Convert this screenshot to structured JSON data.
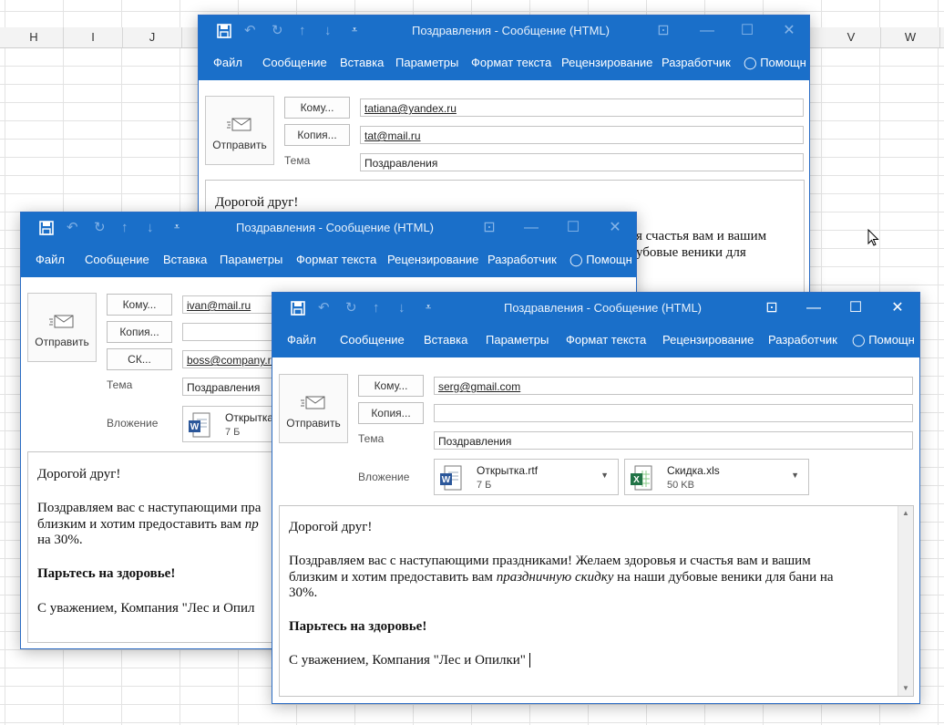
{
  "excel": {
    "columns": [
      "H",
      "I",
      "J",
      "V",
      "W"
    ]
  },
  "colors": {
    "ribbon": "#1a6fc9",
    "word_icon": "#2b579a",
    "excel_icon": "#217346"
  },
  "qat_icons": [
    "save-icon",
    "undo-icon",
    "redo-icon",
    "up-arrow-icon",
    "down-arrow-icon",
    "customize-icon"
  ],
  "menu": [
    "Файл",
    "Сообщение",
    "Вставка",
    "Параметры",
    "Формат текста",
    "Рецензирование",
    "Разработчик",
    "Помощн"
  ],
  "labels": {
    "to": "Кому...",
    "cc": "Копия...",
    "bcc": "СК...",
    "subject": "Тема",
    "attachment": "Вложение",
    "send": "Отправить"
  },
  "window1": {
    "title": "Поздравления - Сообщение (HTML)",
    "to": "tatiana@yandex.ru",
    "cc": "tat@mail.ru",
    "subject": "Поздравления",
    "body": {
      "greeting": "Дорогой друг!",
      "visible_line1": "я счастья вам и вашим",
      "visible_line2": "убовые веники для"
    }
  },
  "window2": {
    "title": "Поздравления - Сообщение (HTML)",
    "to": "ivan@mail.ru",
    "cc": "",
    "bcc": "boss@company.ru",
    "subject": "Поздравления",
    "attachment": {
      "name": "Открытка",
      "size": "7 Б"
    },
    "body": {
      "greeting": "Дорогой друг!",
      "line1": "Поздравляем вас с наступающими пра",
      "line2a": "близким и хотим предоставить вам ",
      "line2b": "пр",
      "line3": "на 30%.",
      "bold": "Парьтесь на здоровье!",
      "sign": "С уважением, Компания \"Лес и Опил"
    }
  },
  "window3": {
    "title": "Поздравления - Сообщение (HTML)",
    "to": "serg@gmail.com",
    "cc": "",
    "subject": "Поздравления",
    "attachments": [
      {
        "name": "Открытка.rtf",
        "size": "7 Б",
        "icon": "word-icon"
      },
      {
        "name": "Скидка.xls",
        "size": "50 KB",
        "icon": "excel-icon"
      }
    ],
    "body": {
      "greeting": "Дорогой друг!",
      "line1": "Поздравляем вас с наступающими праздниками! Желаем здоровья и счастья вам и вашим",
      "line2a": "близким и хотим предоставить вам ",
      "line2b": "праздничную скидку",
      "line2c": " на наши дубовые веники для бани на",
      "line3": "30%.",
      "bold": "Парьтесь на здоровье!",
      "sign": "С уважением, Компания \"Лес и Опилки\""
    }
  }
}
